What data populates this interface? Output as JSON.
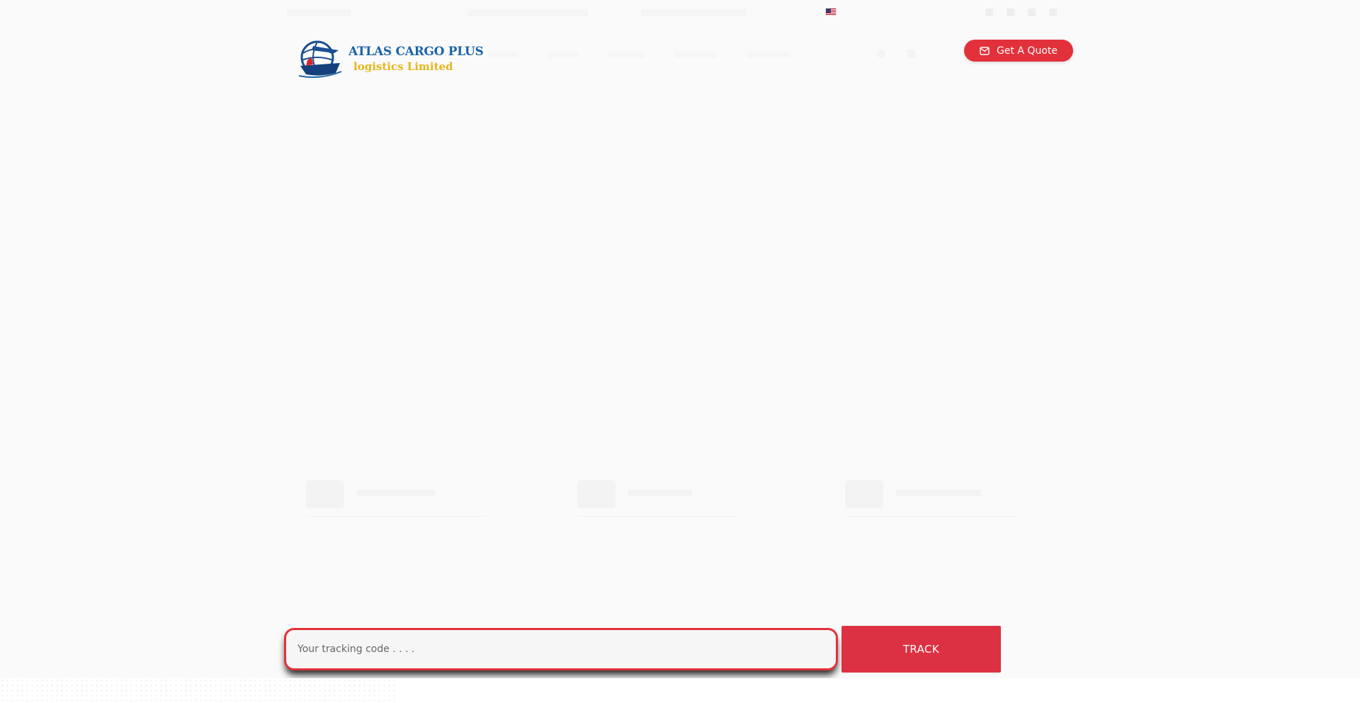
{
  "header": {
    "logo": {
      "line1": "ATLAS CARGO PLUS",
      "line2": "logistics Limited"
    },
    "quote_button": {
      "label": "Get A Quote",
      "icon": "envelope-icon"
    }
  },
  "tracking": {
    "placeholder": "Your tracking code . . . .",
    "button_label": "TRACK"
  },
  "colors": {
    "accent_red": "#e2313a",
    "track_red": "#dc3142",
    "logo_blue": "#1b64a8",
    "logo_yellow": "#e6b619",
    "background": "#fafafa"
  }
}
